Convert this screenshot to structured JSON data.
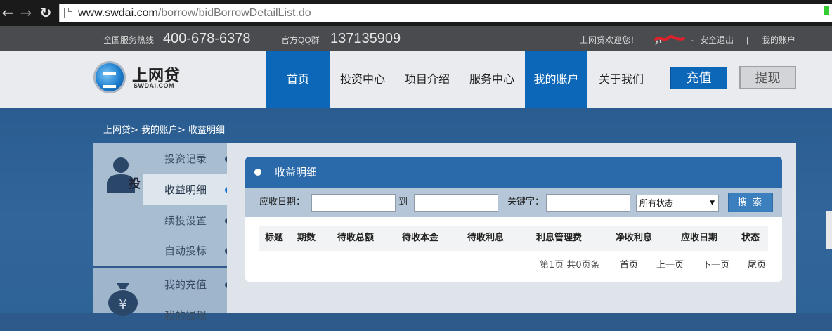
{
  "browser": {
    "url_host": "www.swdai.com",
    "url_path": "/borrow/bidBorrowDetailList.do"
  },
  "topbar": {
    "hotline_label": "全国服务热线",
    "hotline_number": "400-678-6378",
    "qq_label": "官方QQ群",
    "qq_number": "137135909",
    "welcome": "上网贷欢迎您！",
    "username": "yt",
    "dash": "-",
    "logout": "安全退出",
    "separator": "|",
    "my_account": "我的账户"
  },
  "logo": {
    "name": "上网贷",
    "sub": "SWDAI.COM"
  },
  "nav": {
    "items": [
      {
        "label": "首页"
      },
      {
        "label": "投资中心"
      },
      {
        "label": "项目介绍"
      },
      {
        "label": "服务中心"
      },
      {
        "label": "我的账户"
      },
      {
        "label": "关于我们"
      }
    ],
    "recharge": "充值",
    "withdraw": "提现"
  },
  "breadcrumb": "上网贷> 我的账户> 收益明细",
  "sidebar": {
    "section_label": "投",
    "items": [
      {
        "label": "投资记录"
      },
      {
        "label": "收益明细"
      },
      {
        "label": "续投设置"
      },
      {
        "label": "自动投标"
      },
      {
        "label": "我的充值"
      },
      {
        "label": "我的提现"
      }
    ]
  },
  "panel": {
    "title": "收益明细",
    "filter": {
      "date_label": "应收日期：",
      "to_label": "到",
      "keyword_label": "关键字：",
      "status_selected": "所有状态",
      "search_button": "搜 索"
    },
    "columns": [
      "标题",
      "期数",
      "待收总额",
      "待收本金",
      "待收利息",
      "利息管理费",
      "净收利息",
      "应收日期",
      "状态"
    ],
    "pager": {
      "info": "第1页 共0页条",
      "first": "首页",
      "prev": "上一页",
      "next": "下一页",
      "last": "尾页"
    }
  }
}
